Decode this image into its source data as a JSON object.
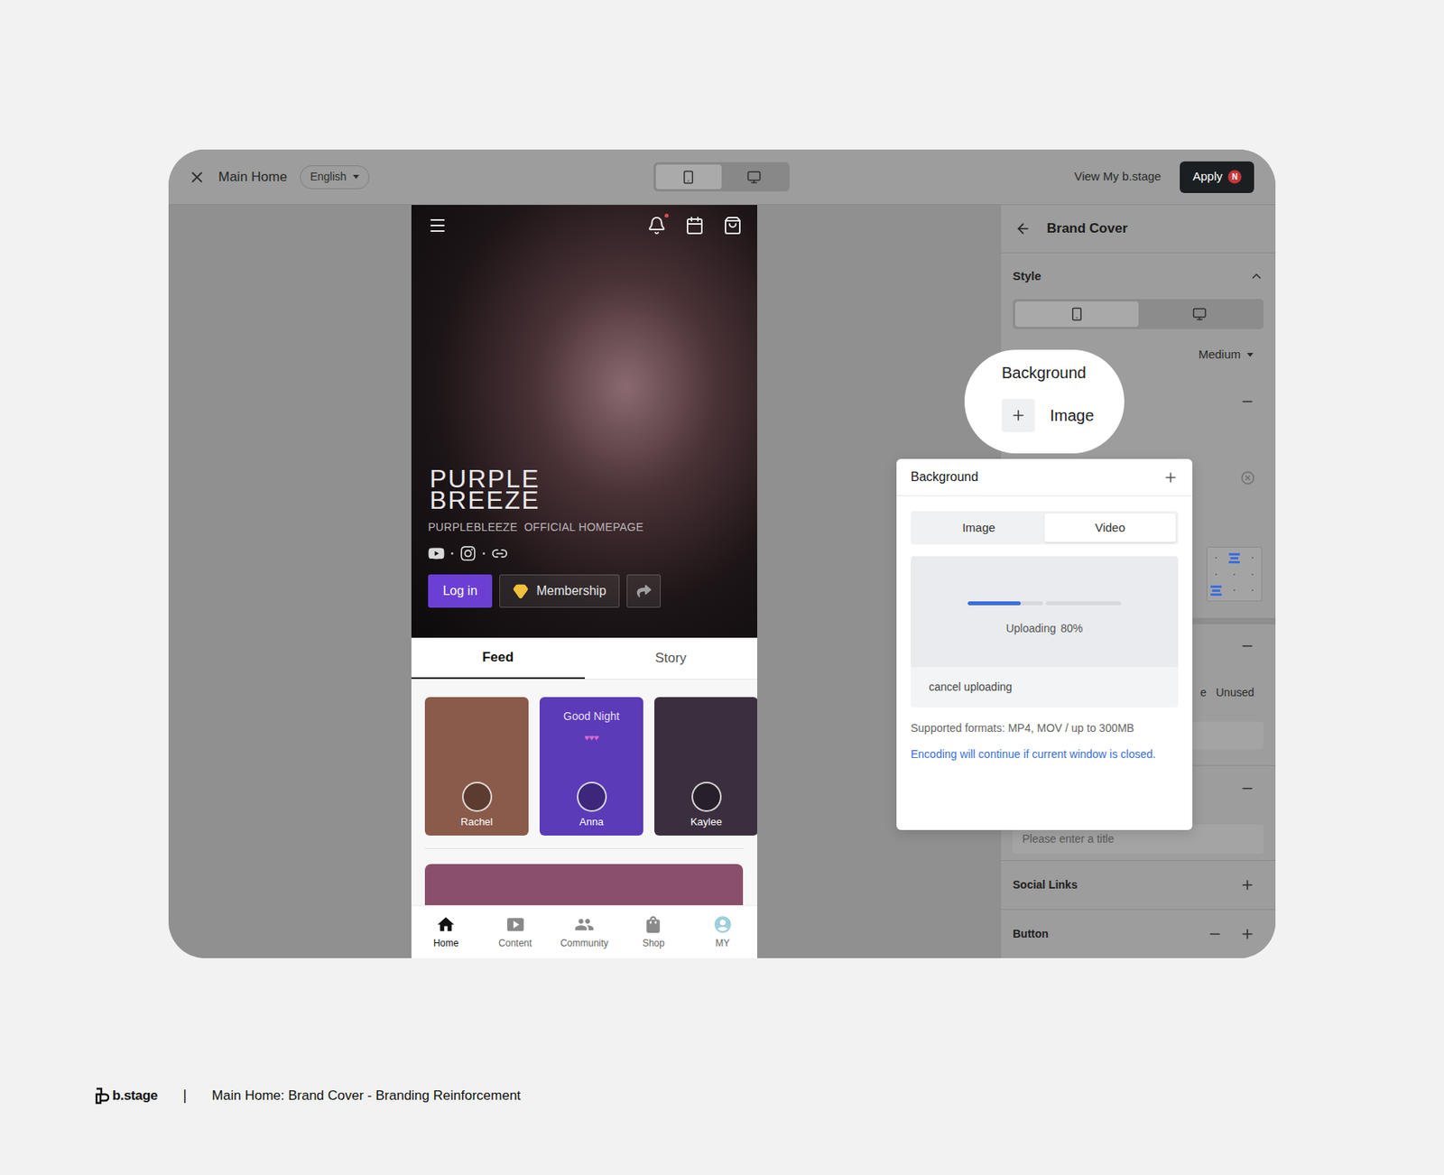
{
  "topbar": {
    "title": "Main Home",
    "language": "English",
    "device_toggle": [
      {
        "kind": "mobile",
        "selected": true
      },
      {
        "kind": "desktop",
        "selected": false
      }
    ],
    "view_link": "View My b.stage",
    "apply": {
      "label": "Apply",
      "badge": "N"
    }
  },
  "preview": {
    "notification_dot": true,
    "title_lines": [
      "PURPLE",
      "BREEZE"
    ],
    "subtitle": "PURPLEBLEEZE  OFFICIAL HOMEPAGE",
    "social": [
      {
        "kind": "youtube"
      },
      {
        "kind": "instagram"
      },
      {
        "kind": "link"
      }
    ],
    "login": "Log in",
    "membership": "Membership",
    "tabs": [
      {
        "label": "Feed",
        "selected": true
      },
      {
        "label": "Story",
        "selected": false
      }
    ],
    "stories": [
      {
        "name": "Rachel",
        "title": "",
        "hearts": "",
        "color": "#8a5a4a"
      },
      {
        "name": "Anna",
        "title": "Good Night",
        "hearts": "♥♥♥",
        "color": "#5b3bb8"
      },
      {
        "name": "Kaylee",
        "title": "",
        "hearts": "",
        "color": "#3b2f3f"
      }
    ],
    "feed_image_color": "#8a4f6a",
    "nav": [
      {
        "kind": "home",
        "label": "Home",
        "selected": true
      },
      {
        "kind": "content",
        "label": "Content",
        "selected": false
      },
      {
        "kind": "community",
        "label": "Community",
        "selected": false
      },
      {
        "kind": "shop",
        "label": "Shop",
        "selected": false
      },
      {
        "kind": "my",
        "label": "MY",
        "selected": false
      }
    ]
  },
  "panel": {
    "title": "Brand Cover",
    "style_label": "Style",
    "style_expanded": true,
    "device_toggle": [
      {
        "kind": "mobile",
        "selected": true
      },
      {
        "kind": "desktop",
        "selected": false
      }
    ],
    "size": "Medium",
    "alignment": [
      {
        "selected": false
      },
      {
        "selected": true
      },
      {
        "selected": false
      },
      {
        "selected": false
      },
      {
        "selected": false
      },
      {
        "selected": false
      },
      {
        "selected": true
      },
      {
        "selected": false
      },
      {
        "selected": false
      }
    ],
    "unused_partial": "e",
    "unused": "Unused",
    "title_placeholder": "Please enter a title",
    "sections": [
      {
        "label": "Social Links",
        "actions": [
          "add"
        ]
      },
      {
        "label": "Button",
        "actions": [
          "remove",
          "add"
        ]
      }
    ]
  },
  "magnifier": {
    "title": "Background",
    "add_label": "Image"
  },
  "modal": {
    "title": "Background",
    "tabs": [
      {
        "label": "Image",
        "selected": false
      },
      {
        "label": "Video",
        "selected": true
      }
    ],
    "upload": {
      "segments": [
        {
          "level": 0.7
        },
        {
          "level": 0
        }
      ],
      "status": "Uploading",
      "percent": "80%",
      "cancel": "cancel uploading"
    },
    "formats": "Supported formats: MP4, MOV / up to 300MB",
    "notice": "Encoding will continue if current window is closed."
  },
  "footer": {
    "logo": "b.stage",
    "separator": "|",
    "caption": "Main Home: Brand Cover - Branding Reinforcement"
  }
}
